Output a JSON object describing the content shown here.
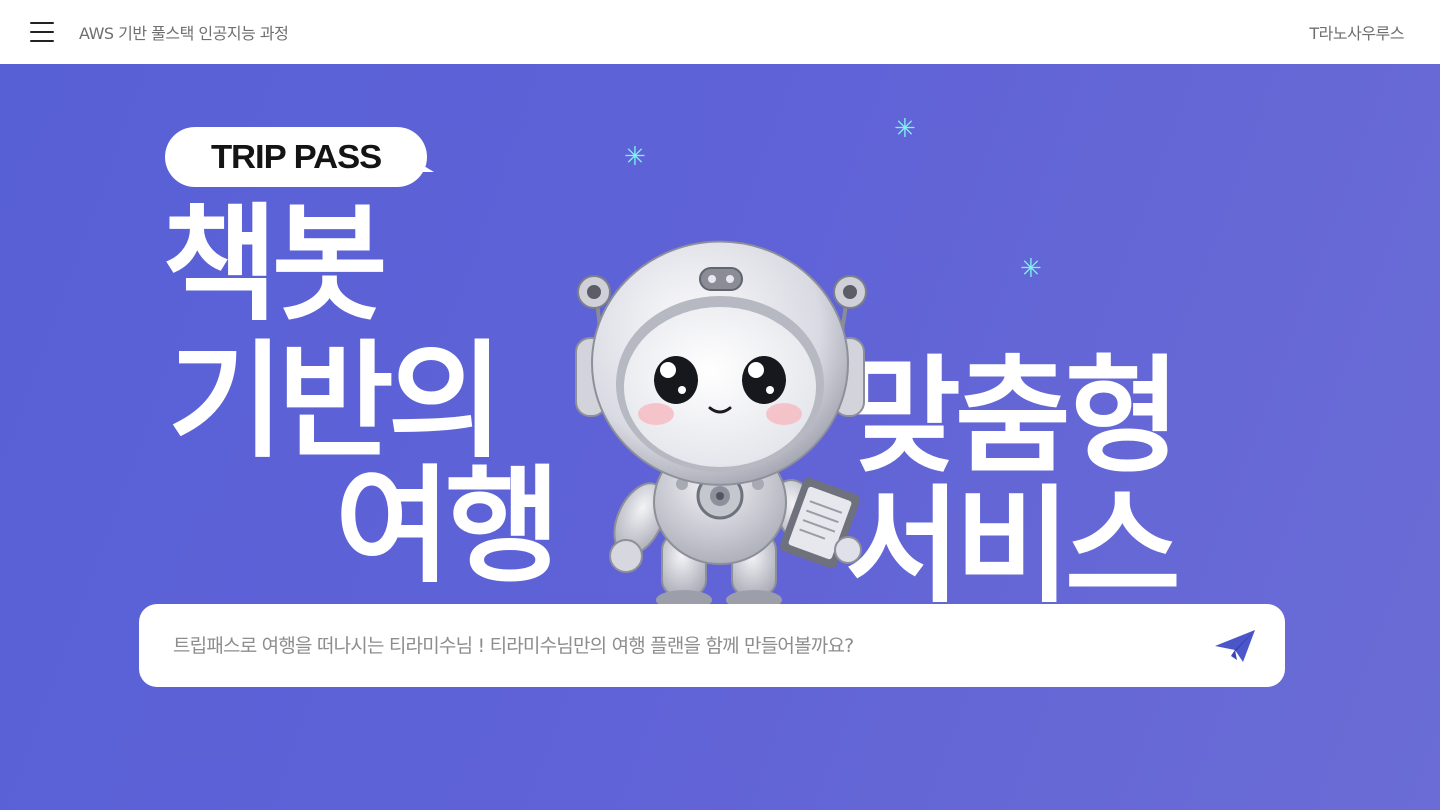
{
  "header": {
    "menu_icon": "hamburger-menu-icon",
    "course_title": "AWS 기반 풀스택 인공지능 과정",
    "team_name": "T라노사우루스"
  },
  "hero": {
    "badge": "TRIP PASS",
    "headline": {
      "line1": "책봇",
      "line2": "기반의",
      "line3": "여행",
      "line4": "맞춤형",
      "line5": "서비스"
    },
    "sparkle": "✳",
    "mascot": "astronaut-robot-mascot"
  },
  "search": {
    "placeholder": "트립패스로 여행을 떠나시는 티라미수님 ! 티라미수님만의 여행 플랜을 함께 만들어볼까요?",
    "send_icon": "paper-plane-send-icon"
  },
  "colors": {
    "hero_bg": "#5c61d7",
    "sparkle": "#7ff2ee",
    "send_icon": "#4a56c9"
  }
}
